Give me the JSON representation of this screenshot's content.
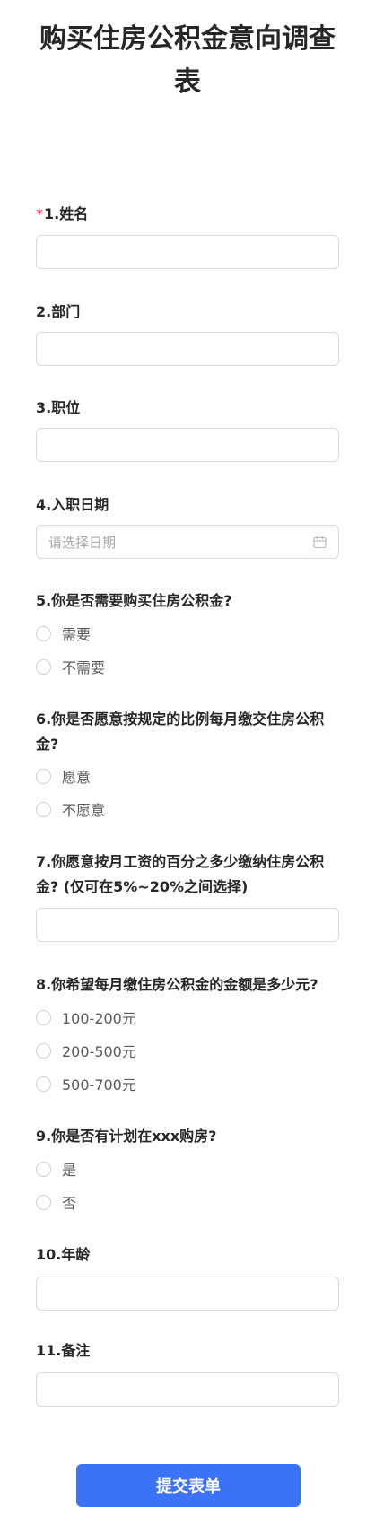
{
  "form": {
    "title": "购买住房公积金意向调查表",
    "submit_label": "提交表单"
  },
  "questions": {
    "q1": {
      "required_mark": "*",
      "label": "1.姓名",
      "value": ""
    },
    "q2": {
      "label": "2.部门",
      "value": ""
    },
    "q3": {
      "label": "3.职位",
      "value": ""
    },
    "q4": {
      "label": "4.入职日期",
      "placeholder": "请选择日期",
      "icon": "calendar-icon"
    },
    "q5": {
      "label": "5.你是否需要购买住房公积金?",
      "options": [
        "需要",
        "不需要"
      ]
    },
    "q6": {
      "label": "6.你是否愿意按规定的比例每月缴交住房公积金?",
      "options": [
        "愿意",
        "不愿意"
      ]
    },
    "q7": {
      "label": "7.你愿意按月工资的百分之多少缴纳住房公积金? (仅可在5%~20%之间选择)",
      "value": ""
    },
    "q8": {
      "label": "8.你希望每月缴住房公积金的金额是多少元?",
      "options": [
        "100-200元",
        "200-500元",
        "500-700元"
      ]
    },
    "q9": {
      "label": "9.你是否有计划在xxx购房?",
      "options": [
        "是",
        "否"
      ]
    },
    "q10": {
      "label": "10.年龄",
      "value": ""
    },
    "q11": {
      "label": "11.备注",
      "value": ""
    }
  }
}
